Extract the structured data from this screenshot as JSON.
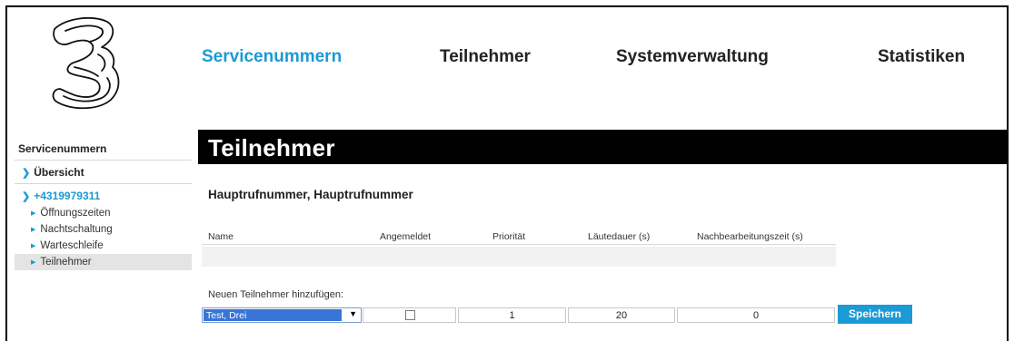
{
  "topnav": {
    "items": [
      {
        "label": "Servicenummern",
        "active": true
      },
      {
        "label": "Teilnehmer",
        "active": false
      },
      {
        "label": "Systemverwaltung",
        "active": false
      },
      {
        "label": "Statistiken",
        "active": false
      }
    ]
  },
  "sidebar": {
    "heading": "Servicenummern",
    "overview": "Übersicht",
    "number": "+4319979311",
    "subitems": [
      "Öffnungszeiten",
      "Nachtschaltung",
      "Warteschleife",
      "Teilnehmer"
    ],
    "active_subitem": "Teilnehmer"
  },
  "main": {
    "title": "Teilnehmer",
    "subtitle": "Hauptrufnummer, Hauptrufnummer",
    "table": {
      "columns": [
        "Name",
        "Angemeldet",
        "Priorität",
        "Läutedauer (s)",
        "Nachbearbeitungszeit (s)"
      ],
      "rows": []
    },
    "add_form": {
      "label": "Neuen Teilnehmer hinzufügen:",
      "selected_name": "Test, Drei",
      "logged_in": false,
      "priority": "1",
      "ring_duration": "20",
      "wrapup_time": "0",
      "save_label": "Speichern"
    }
  },
  "colors": {
    "accent": "#1b9ad6",
    "title_bar": "#000000",
    "select_highlight": "#3875d7"
  },
  "icons": [
    "three-logo",
    "chevron-right-icon",
    "triangle-bullet-icon",
    "dropdown-arrow-icon",
    "checkbox-icon"
  ]
}
